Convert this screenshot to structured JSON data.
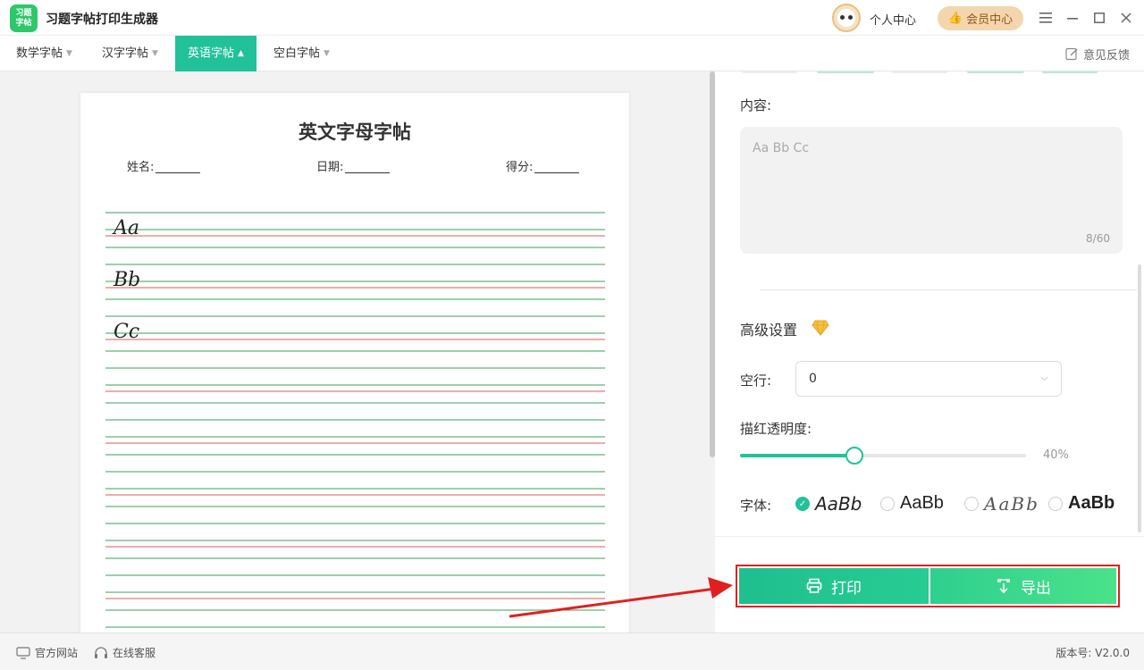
{
  "app": {
    "logo_line1": "习题",
    "logo_line2": "字帖",
    "title": "习题字帖打印生成器"
  },
  "header": {
    "personal_center": "个人中心",
    "vip_center": "会员中心"
  },
  "tabs": [
    {
      "label": "数学字帖"
    },
    {
      "label": "汉字字帖"
    },
    {
      "label": "英语字帖"
    },
    {
      "label": "空白字帖"
    }
  ],
  "feedback": "意见反馈",
  "paper": {
    "title": "英文字母字帖",
    "name_label": "姓名:",
    "date_label": "日期:",
    "score_label": "得分:",
    "letters": [
      "Aa",
      "Bb",
      "Cc"
    ]
  },
  "settings": {
    "content_label": "内容:",
    "content_value": "Aa Bb Cc",
    "char_count": "8/60",
    "advanced_title": "高级设置",
    "blank_rows_label": "空行:",
    "blank_rows_value": "0",
    "opacity_label": "描红透明度:",
    "opacity_value": 0.4,
    "opacity_text": "40%",
    "font_label": "字体:",
    "font_samples": [
      "AaBb",
      "AaBb",
      "AaBb",
      "AaBb"
    ],
    "selected_font": 0
  },
  "actions": {
    "print": "打印",
    "export": "导出"
  },
  "status": {
    "website": "官方网站",
    "service": "在线客服",
    "version": "版本号: V2.0.0"
  },
  "colors": {
    "accent": "#21c29a",
    "red_line": "#e05a5a",
    "green_line": "#3aa05a",
    "annot_red": "#e02020"
  }
}
